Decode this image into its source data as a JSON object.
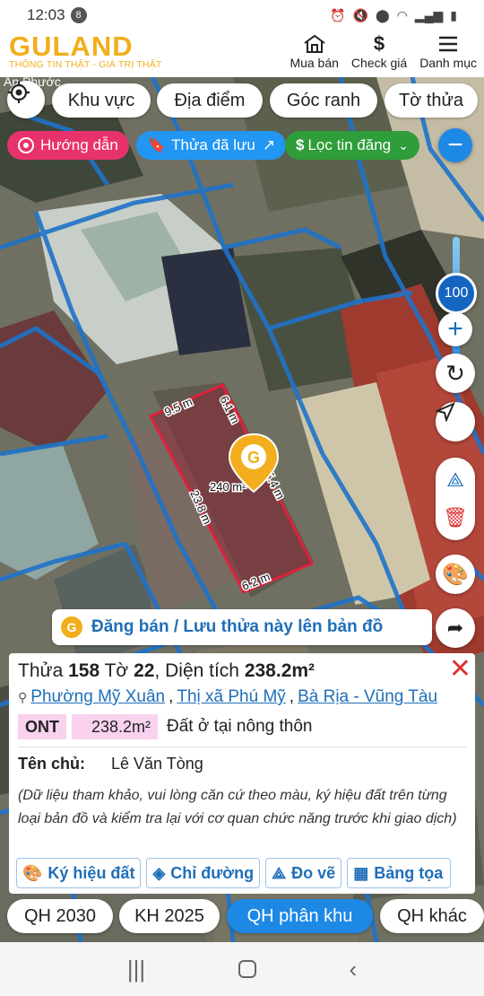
{
  "status": {
    "time": "12:03",
    "notif_count": "8"
  },
  "header": {
    "brand": "GULAND",
    "tagline": "THÔNG TIN THẬT - GIÁ TRỊ THẬT",
    "nav": [
      {
        "label": "Mua bán",
        "icon": "house-icon"
      },
      {
        "label": "Check giá",
        "icon": "dollar-icon"
      },
      {
        "label": "Danh mục",
        "icon": "menu-icon"
      }
    ]
  },
  "map": {
    "top_chips": [
      "Khu vực",
      "Địa điểm",
      "Góc ranh",
      "Tờ thửa"
    ],
    "pills": {
      "guide": "Hướng dẫn",
      "saved": "Thửa đã lưu",
      "filter": "Lọc tin đăng"
    },
    "zoom_value": "100",
    "parcel": {
      "area_label": "240 m²",
      "edge_top": "9.5 m",
      "edge_top_right": "6.1 m",
      "edge_right": "15.4 m",
      "edge_left": "23.8 m",
      "edge_bottom": "6.2 m"
    },
    "place_label": "An Phước",
    "promo_text": "Đăng bán / Lưu thửa này lên bản đồ"
  },
  "card": {
    "title_prefix": "Thửa",
    "parcel_no": "158",
    "sheet_label": "Tờ",
    "sheet_no": "22",
    "area_label": "Diện tích",
    "area_value": "238.2m²",
    "ward": "Phường Mỹ Xuân",
    "town": "Thị xã Phú Mỹ",
    "province": "Bà Rịa - Vũng Tàu",
    "land_code": "ONT",
    "land_area": "238.2m²",
    "land_desc": "Đất ở tại nông thôn",
    "owner_label": "Tên chủ:",
    "owner_name": "Lê Văn Tòng",
    "note": "(Dữ liệu tham khảo, vui lòng căn cứ theo màu, ký hiệu đất trên từng loại bản đồ và kiểm tra lại với cơ quan chức năng trước khi giao dịch)",
    "actions": [
      "Ký hiệu đất",
      "Chỉ đường",
      "Đo vẽ",
      "Bảng tọa"
    ]
  },
  "tabs": [
    "QH 2030",
    "KH 2025",
    "QH phân khu",
    "QH khác"
  ],
  "colors": {
    "brand": "#f2ae1c",
    "accent": "#1e88e5",
    "guide": "#e8326b",
    "saved": "#2196f3",
    "filter": "#2e9d3a",
    "parcel": "#e0203a"
  }
}
